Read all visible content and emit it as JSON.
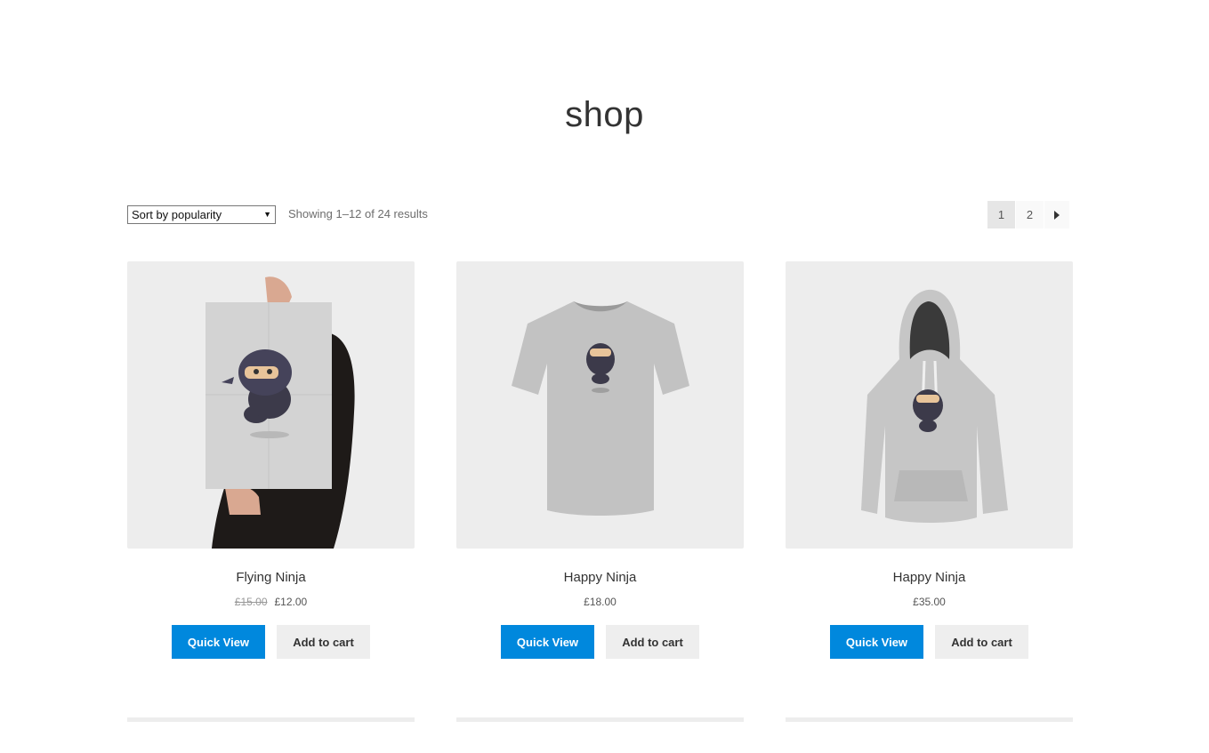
{
  "page": {
    "title": "shop"
  },
  "toolbar": {
    "sort_selected": "Sort by popularity",
    "result_count": "Showing 1–12 of 24 results"
  },
  "pagination": {
    "pages": [
      "1",
      "2"
    ],
    "current": "1",
    "next_icon": "chevron-right-icon"
  },
  "products": [
    {
      "name": "Flying Ninja",
      "price_old": "£15.00",
      "price": "£12.00",
      "quick_view": "Quick View",
      "add_to_cart": "Add to cart"
    },
    {
      "name": "Happy Ninja",
      "price_old": "",
      "price": "£18.00",
      "quick_view": "Quick View",
      "add_to_cart": "Add to cart"
    },
    {
      "name": "Happy Ninja",
      "price_old": "",
      "price": "£35.00",
      "quick_view": "Quick View",
      "add_to_cart": "Add to cart"
    }
  ],
  "colors": {
    "accent": "#0088dd",
    "secondary_button": "#eeeeee",
    "thumb_bg": "#ededed"
  }
}
